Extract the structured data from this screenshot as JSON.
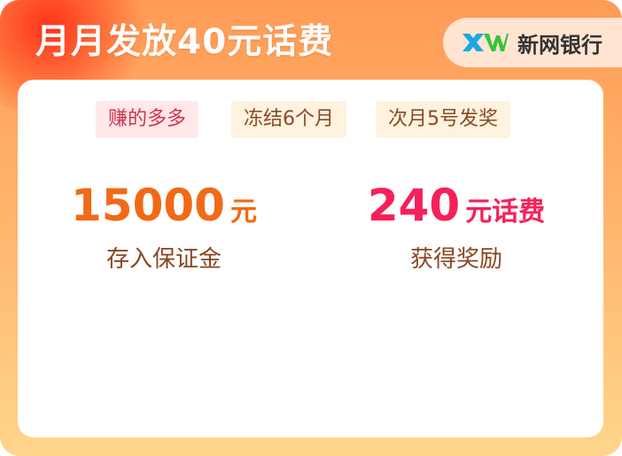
{
  "header": {
    "title": "月月发放40元话费",
    "bank_logo_text": "XW",
    "bank_name": "新网银行",
    "colors": {
      "logo_blue": "#1aa7e8",
      "logo_green": "#35c33a"
    }
  },
  "tags": [
    {
      "label": "赚的多多"
    },
    {
      "label": "冻结6个月"
    },
    {
      "label": "次月5号发奖"
    }
  ],
  "stats": [
    {
      "value": "15000",
      "unit": "元",
      "label": "存入保证金"
    },
    {
      "value": "240",
      "unit": "元话费",
      "label": "获得奖励"
    }
  ]
}
